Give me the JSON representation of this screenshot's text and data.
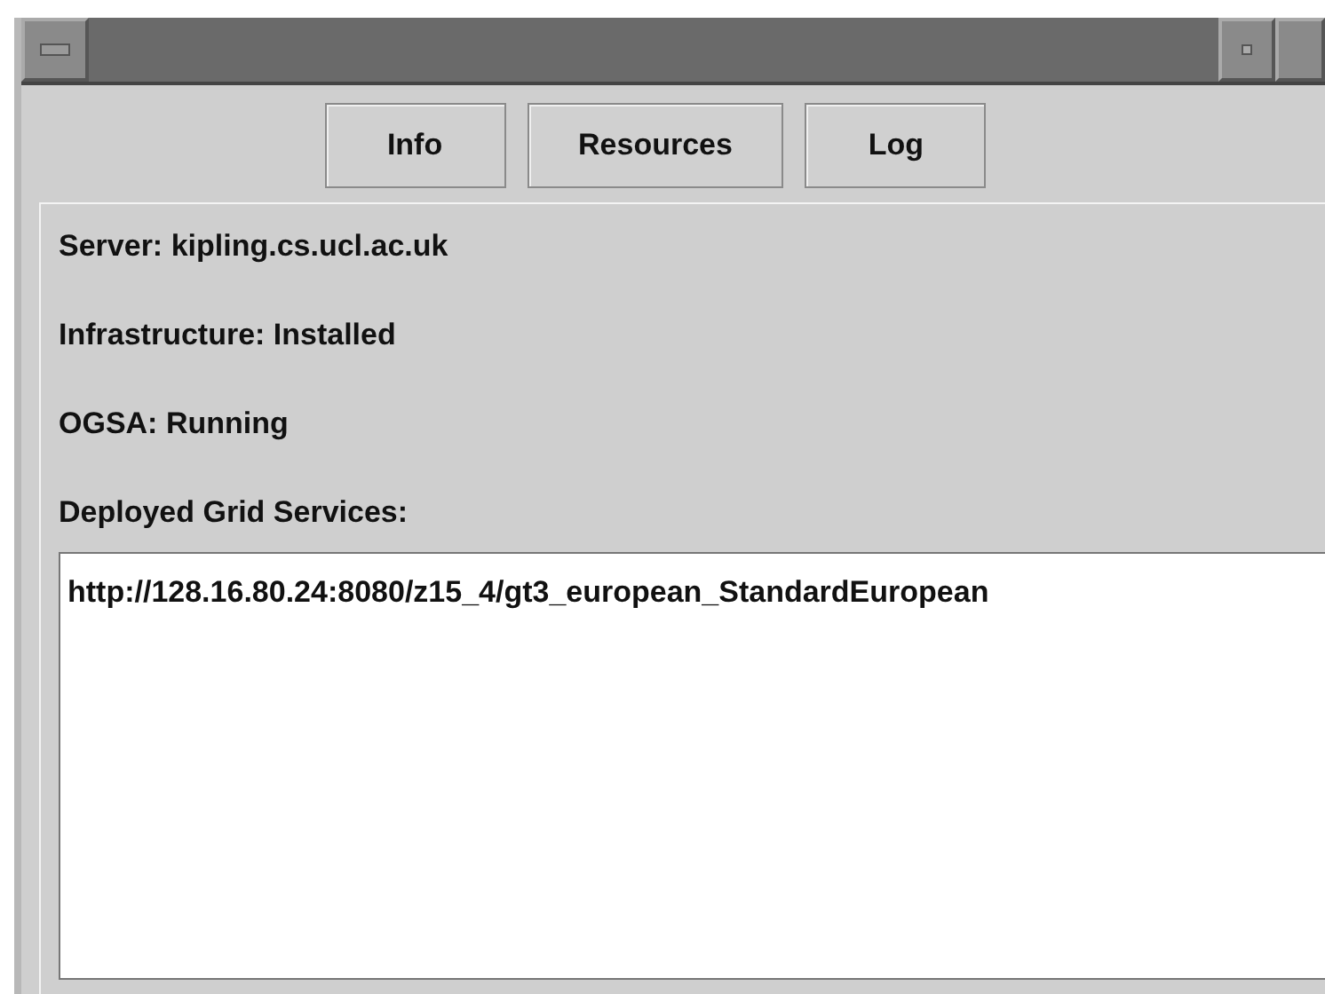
{
  "tabs": [
    {
      "label": "Info",
      "selected": false
    },
    {
      "label": "Resources",
      "selected": false
    },
    {
      "label": "Log",
      "selected": false
    }
  ],
  "info": [
    {
      "text": "Server: kipling.cs.ucl.ac.uk"
    },
    {
      "text": "Infrastructure: Installed"
    },
    {
      "text": "OGSA: Running"
    },
    {
      "text": "Deployed Grid Services:"
    }
  ],
  "services": [
    "http://128.16.80.24:8080/z15_4/gt3_european_StandardEuropean"
  ]
}
